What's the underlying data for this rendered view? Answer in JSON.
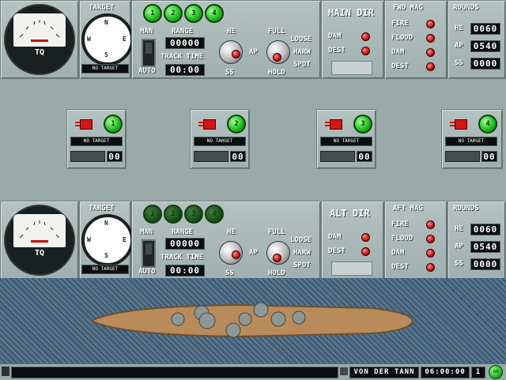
{
  "top_station": {
    "gauge_label": "TQ",
    "target_title": "TARGET",
    "target_status": "NO TARGET",
    "turret_buttons": [
      "1",
      "2",
      "3",
      "4"
    ],
    "man": "MAN",
    "auto": "AUTO",
    "range_label": "RANGE",
    "range_value": "00000",
    "track_time_label": "TRACK TIME",
    "track_time_value": "00:00",
    "he_label": "HE",
    "ap_label": "AP",
    "ss_label": "SS",
    "full_label": "FULL",
    "hold_label": "HOLD",
    "loose": "LOOSE",
    "harw": "HARW",
    "spot": "SPOT",
    "dir_title": "MAIN DIR",
    "dam": "DAM",
    "dest": "DEST",
    "mag_title": "FWD MAG",
    "mag_rows": [
      "FIRE",
      "FLOOD",
      "DAM",
      "DEST"
    ],
    "rounds_title": "ROUNDS",
    "rounds": [
      {
        "label": "HE",
        "value": "0060"
      },
      {
        "label": "AP",
        "value": "0540"
      },
      {
        "label": "SS",
        "value": "0000"
      }
    ]
  },
  "mounts": [
    {
      "num": "1",
      "status": "NO TARGET",
      "count": "00"
    },
    {
      "num": "2",
      "status": "NO TARGET",
      "count": "00"
    },
    {
      "num": "3",
      "status": "NO TARGET",
      "count": "00"
    },
    {
      "num": "4",
      "status": "NO TARGET",
      "count": "00"
    }
  ],
  "bottom_station": {
    "gauge_label": "TQ",
    "target_title": "TARGET",
    "target_status": "NO TARGET",
    "turret_buttons": [
      "1",
      "2",
      "3",
      "4"
    ],
    "man": "MAN",
    "auto": "AUTO",
    "range_label": "RANGE",
    "range_value": "00000",
    "track_time_label": "TRACK TIME",
    "track_time_value": "00:00",
    "he_label": "HE",
    "ap_label": "AP",
    "ss_label": "SS",
    "full_label": "FULL",
    "hold_label": "HOLD",
    "loose": "LOOSE",
    "harw": "HARW",
    "spot": "SPOT",
    "dir_title": "ALT DIR",
    "dam": "DAM",
    "dest": "DEST",
    "mag_title": "AFT MAG",
    "mag_rows": [
      "FIRE",
      "FLOOD",
      "DAM",
      "DEST"
    ],
    "rounds_title": "ROUNDS",
    "rounds": [
      {
        "label": "HE",
        "value": "0060"
      },
      {
        "label": "AP",
        "value": "0540"
      },
      {
        "label": "SS",
        "value": "0000"
      }
    ]
  },
  "statusbar": {
    "ship_name": "VON DER TANN",
    "clock": "06:00:00",
    "page": "1",
    "go": "GO"
  },
  "colors": {
    "led_red": "#c01010",
    "button_green": "#1fbf1f",
    "panel": "#a9b8b6"
  }
}
